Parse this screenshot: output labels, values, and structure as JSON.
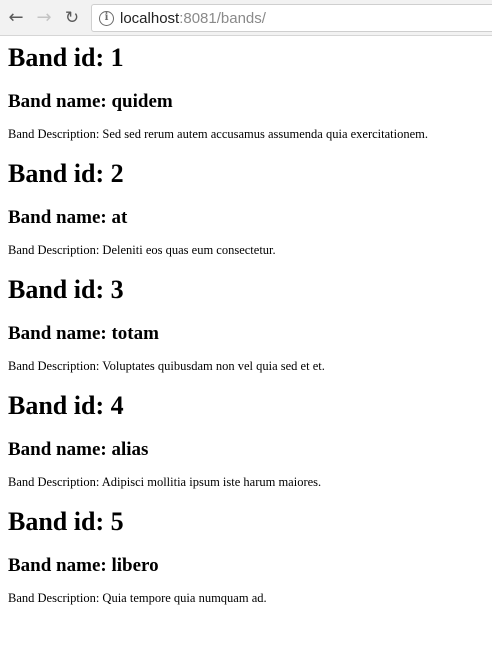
{
  "browser": {
    "back_icon": "arrow-left-icon",
    "forward_icon": "arrow-right-icon",
    "reload_icon": "reload-icon",
    "info_icon": "info-icon",
    "url_host": "localhost",
    "url_rest": ":8081/bands/"
  },
  "bands": [
    {
      "id_heading": "Band id: 1",
      "name_heading": "Band name: quidem",
      "description": "Band Description: Sed sed rerum autem accusamus assumenda quia exercitationem."
    },
    {
      "id_heading": "Band id: 2",
      "name_heading": "Band name: at",
      "description": "Band Description: Deleniti eos quas eum consectetur."
    },
    {
      "id_heading": "Band id: 3",
      "name_heading": "Band name: totam",
      "description": "Band Description: Voluptates quibusdam non vel quia sed et et."
    },
    {
      "id_heading": "Band id: 4",
      "name_heading": "Band name: alias",
      "description": "Band Description: Adipisci mollitia ipsum iste harum maiores."
    },
    {
      "id_heading": "Band id: 5",
      "name_heading": "Band name: libero",
      "description": "Band Description: Quia tempore quia numquam ad."
    }
  ]
}
